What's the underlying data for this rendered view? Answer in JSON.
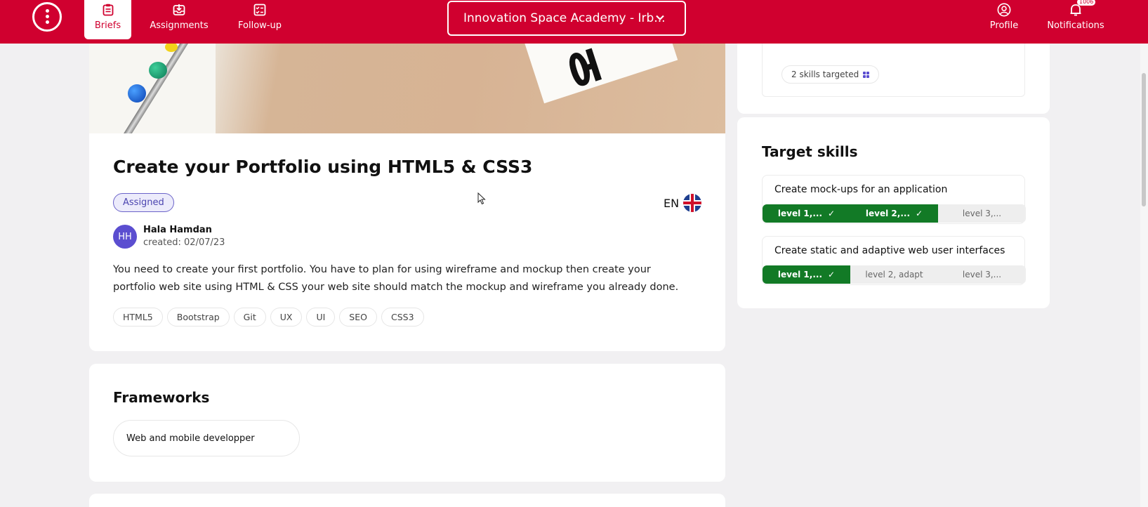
{
  "nav": {
    "briefs": "Briefs",
    "assignments": "Assignments",
    "followup": "Follow-up",
    "school": "Innovation Space Academy - Irb...",
    "profile": "Profile",
    "notifications": "Notifications",
    "notif_count": "1006"
  },
  "brief": {
    "title": "Create your Portfolio using HTML5 & CSS3",
    "status": "Assigned",
    "lang": "EN",
    "author_initials": "HH",
    "author_name": "Hala Hamdan",
    "created": "created: 02/07/23",
    "description": "You need to create your first portfolio. You have to plan for using wireframe and mockup then create your portfolio web site using HTML & CSS your web site should match the mockup and wireframe you already done.",
    "tags": [
      "HTML5",
      "Bootstrap",
      "Git",
      "UX",
      "UI",
      "SEO",
      "CSS3"
    ]
  },
  "frameworks": {
    "title": "Frameworks",
    "items": [
      "Web and mobile developper"
    ]
  },
  "sidebar": {
    "skills_targeted": "2 skills targeted"
  },
  "target_skills": {
    "title": "Target skills",
    "skills": [
      {
        "name": "Create mock-ups for an application",
        "levels": [
          "level 1,...",
          "level 2,...",
          "level 3,..."
        ]
      },
      {
        "name": "Create static and adaptive web user interfaces",
        "levels": [
          "level 1,...",
          "level 2, adapt",
          "level 3,..."
        ]
      }
    ]
  },
  "colors": {
    "brand": "#d0002f",
    "done": "#127a26",
    "accent": "#5b4ed0"
  }
}
